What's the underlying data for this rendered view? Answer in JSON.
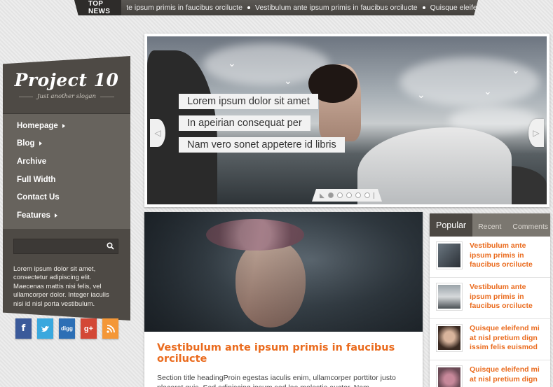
{
  "ticker": {
    "label": "TOP NEWS",
    "items": [
      "te ipsum primis in faucibus orciluctе",
      "Vestibulum ante ipsum primis in faucibus orcilucte",
      "Quisque eleifend"
    ]
  },
  "sidebar": {
    "logo": "Project 10",
    "slogan": "Just another slogan",
    "nav": [
      {
        "label": "Homepage",
        "has_submenu": true
      },
      {
        "label": "Blog",
        "has_submenu": true
      },
      {
        "label": "Archive",
        "has_submenu": false
      },
      {
        "label": "Full Width",
        "has_submenu": false
      },
      {
        "label": "Contact Us",
        "has_submenu": false
      },
      {
        "label": "Features",
        "has_submenu": true
      }
    ],
    "search_value": "",
    "text": "Lorem ipsum dolor sit amet, consectetur adipiscing elit. Maecenas mattis nisi felis, vel ullamcorper dolor. Integer iaculis nisi id nisl porta vestibulum."
  },
  "social": [
    {
      "icon": "facebook-icon",
      "glyph": "f"
    },
    {
      "icon": "twitter-icon",
      "glyph": "t"
    },
    {
      "icon": "digg-icon",
      "glyph": "digg"
    },
    {
      "icon": "google-plus-icon",
      "glyph": "g+"
    },
    {
      "icon": "rss-icon",
      "glyph": "rss"
    }
  ],
  "slider": {
    "captions": [
      "Lorem ipsum dolor sit amet",
      "In apeirian consequat per",
      "Nam vero sonet appetere id libris"
    ],
    "slide_count": 5,
    "active_slide": 1
  },
  "post": {
    "title": "Vestibulum ante ipsum primis in faucibus orcilucte",
    "excerpt": "Section title headingProin egestas iaculis enim, ullamcorper porttitor justo placerat quis. Sed adipiscing ipsum sed leo molestie auctor. Nam"
  },
  "widget": {
    "tabs": [
      "Popular",
      "Recent",
      "Comments"
    ],
    "active_tab": 0,
    "items": [
      {
        "title": "Vestibulum ante ipsum primis in faucibus orcilucte"
      },
      {
        "title": "Vestibulum ante ipsum primis in faucibus orcilucte"
      },
      {
        "title": "Quisque eleifend mi at nisl pretium dign issim felis euismod"
      },
      {
        "title": "Quisque eleifend mi at nisl pretium dign"
      }
    ]
  },
  "colors": {
    "accent": "#ea6b1e",
    "sidebar_bg": "#4e4a45",
    "nav_bg": "#67635d"
  }
}
